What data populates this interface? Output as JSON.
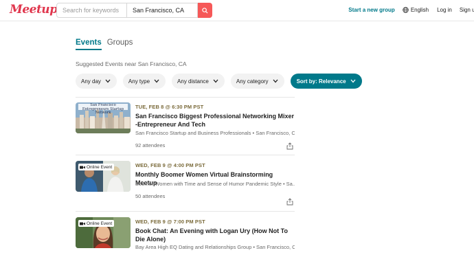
{
  "header": {
    "logo": "Meetup",
    "search_placeholder": "Search for keywords",
    "location": "San Francisco, CA",
    "start_group": "Start a new group",
    "language": "English",
    "login": "Log in",
    "signup": "Sign up"
  },
  "tabs": [
    {
      "label": "Events",
      "active": true
    },
    {
      "label": "Groups",
      "active": false
    }
  ],
  "subtitle": "Suggested Events near San Francisco, CA",
  "filters": [
    {
      "label": "Any day"
    },
    {
      "label": "Any type"
    },
    {
      "label": "Any distance"
    },
    {
      "label": "Any category"
    },
    {
      "label": "Sort by: Relevance"
    }
  ],
  "events": [
    {
      "date": "TUE, FEB 8 @ 6:30 PM PST",
      "title": "San Francisco Biggest Professional Networking Mixer -Entrepreneur And Tech",
      "group": "San Francisco Startup and Business Professionals • San Francisco, CA",
      "attendees": "92 attendees",
      "thumb_text": "San Francisco Entrepreneurs Startup Network"
    },
    {
      "date": "WED, FEB 9 @ 4:00 PM PST",
      "title": "Monthly Boomer Women Virtual Brainstorming Meetup",
      "group": "Boomer Women with Time and Sense of Humor Pandemic Style • Sa...",
      "attendees": "50 attendees",
      "badge": "Online Event"
    },
    {
      "date": "WED, FEB 9 @ 7:00 PM PST",
      "title": "Book Chat: An Evening with Logan Ury (How Not To Die Alone)",
      "group": "Bay Area High EQ Dating and Relationships Group • San Francisco, CA",
      "badge": "Online Event"
    }
  ],
  "colors": {
    "brand": "#e0364d",
    "accent": "#00798a",
    "search_button": "#f65858"
  }
}
